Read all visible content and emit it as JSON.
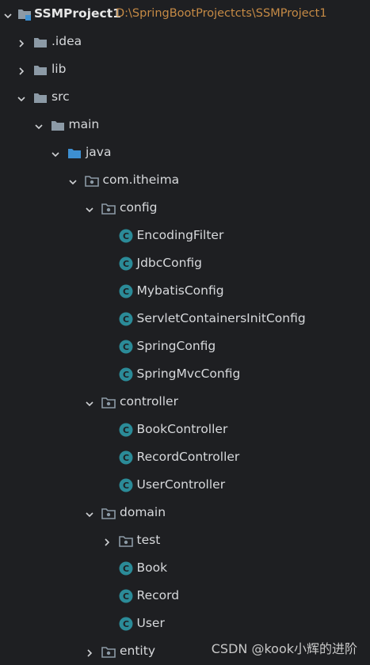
{
  "tree": [
    {
      "label": "SSMProject1",
      "path": "D:\\SpringBootProjectcts\\SSMProject1",
      "icon": "module-folder-icon",
      "expanded": true,
      "depth": 0,
      "bold": true
    },
    {
      "label": ".idea",
      "icon": "folder-icon",
      "expanded": false,
      "depth": 1
    },
    {
      "label": "lib",
      "icon": "folder-icon",
      "expanded": false,
      "depth": 1
    },
    {
      "label": "src",
      "icon": "folder-icon",
      "expanded": true,
      "depth": 1
    },
    {
      "label": "main",
      "icon": "folder-icon",
      "expanded": true,
      "depth": 2
    },
    {
      "label": "java",
      "icon": "source-folder-icon",
      "expanded": true,
      "depth": 3
    },
    {
      "label": "com.itheima",
      "icon": "package-icon",
      "expanded": true,
      "depth": 4
    },
    {
      "label": "config",
      "icon": "package-icon",
      "expanded": true,
      "depth": 5
    },
    {
      "label": "EncodingFilter",
      "icon": "class-icon",
      "depth": 6
    },
    {
      "label": "JdbcConfig",
      "icon": "class-icon",
      "depth": 6
    },
    {
      "label": "MybatisConfig",
      "icon": "class-icon",
      "depth": 6
    },
    {
      "label": "ServletContainersInitConfig",
      "icon": "class-icon",
      "depth": 6
    },
    {
      "label": "SpringConfig",
      "icon": "class-icon",
      "depth": 6
    },
    {
      "label": "SpringMvcConfig",
      "icon": "class-icon",
      "depth": 6
    },
    {
      "label": "controller",
      "icon": "package-icon",
      "expanded": true,
      "depth": 5
    },
    {
      "label": "BookController",
      "icon": "class-icon",
      "depth": 6
    },
    {
      "label": "RecordController",
      "icon": "class-icon",
      "depth": 6
    },
    {
      "label": "UserController",
      "icon": "class-icon",
      "depth": 6
    },
    {
      "label": "domain",
      "icon": "package-icon",
      "expanded": true,
      "depth": 5
    },
    {
      "label": "test",
      "icon": "package-icon",
      "expanded": false,
      "depth": 6
    },
    {
      "label": "Book",
      "icon": "class-icon",
      "depth": 6
    },
    {
      "label": "Record",
      "icon": "class-icon",
      "depth": 6
    },
    {
      "label": "User",
      "icon": "class-icon",
      "depth": 6
    },
    {
      "label": "entity",
      "icon": "package-icon",
      "expanded": false,
      "depth": 5
    }
  ],
  "watermark": "CSDN @kook小辉的进阶",
  "colors": {
    "background": "#1e1f22",
    "text": "#d7d9dc",
    "path": "#c58a45",
    "folder": "#8c9aa6",
    "source_folder": "#3d8fd1",
    "class": "#2b8b98"
  }
}
